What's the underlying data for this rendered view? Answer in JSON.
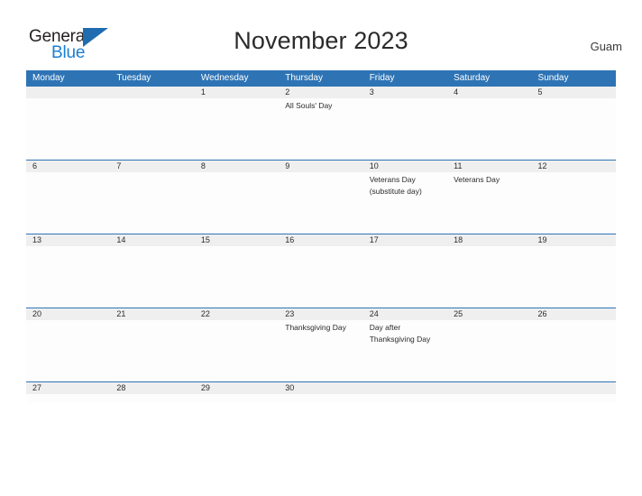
{
  "brand": {
    "name_part1": "General",
    "name_part2": "Blue",
    "flag_icon": "blue-flag-triangle"
  },
  "header": {
    "title": "November 2023",
    "region": "Guam"
  },
  "calendar": {
    "weekdays": [
      "Monday",
      "Tuesday",
      "Wednesday",
      "Thursday",
      "Friday",
      "Saturday",
      "Sunday"
    ],
    "colors": {
      "header_bar": "#2e74b5",
      "date_strip": "#efefef",
      "row_divider": "#2e74b5",
      "brand_blue": "#1a7fd4"
    },
    "weeks": [
      {
        "days": [
          {
            "date": "",
            "events": []
          },
          {
            "date": "",
            "events": []
          },
          {
            "date": "1",
            "events": []
          },
          {
            "date": "2",
            "events": [
              "All Souls' Day"
            ]
          },
          {
            "date": "3",
            "events": []
          },
          {
            "date": "4",
            "events": []
          },
          {
            "date": "5",
            "events": []
          }
        ]
      },
      {
        "days": [
          {
            "date": "6",
            "events": []
          },
          {
            "date": "7",
            "events": []
          },
          {
            "date": "8",
            "events": []
          },
          {
            "date": "9",
            "events": []
          },
          {
            "date": "10",
            "events": [
              "Veterans Day",
              "(substitute day)"
            ]
          },
          {
            "date": "11",
            "events": [
              "Veterans Day"
            ]
          },
          {
            "date": "12",
            "events": []
          }
        ]
      },
      {
        "days": [
          {
            "date": "13",
            "events": []
          },
          {
            "date": "14",
            "events": []
          },
          {
            "date": "15",
            "events": []
          },
          {
            "date": "16",
            "events": []
          },
          {
            "date": "17",
            "events": []
          },
          {
            "date": "18",
            "events": []
          },
          {
            "date": "19",
            "events": []
          }
        ]
      },
      {
        "days": [
          {
            "date": "20",
            "events": []
          },
          {
            "date": "21",
            "events": []
          },
          {
            "date": "22",
            "events": []
          },
          {
            "date": "23",
            "events": [
              "Thanksgiving Day"
            ]
          },
          {
            "date": "24",
            "events": [
              "Day after",
              "Thanksgiving Day"
            ]
          },
          {
            "date": "25",
            "events": []
          },
          {
            "date": "26",
            "events": []
          }
        ]
      },
      {
        "days": [
          {
            "date": "27",
            "events": []
          },
          {
            "date": "28",
            "events": []
          },
          {
            "date": "29",
            "events": []
          },
          {
            "date": "30",
            "events": []
          },
          {
            "date": "",
            "events": []
          },
          {
            "date": "",
            "events": []
          },
          {
            "date": "",
            "events": []
          }
        ]
      }
    ]
  }
}
